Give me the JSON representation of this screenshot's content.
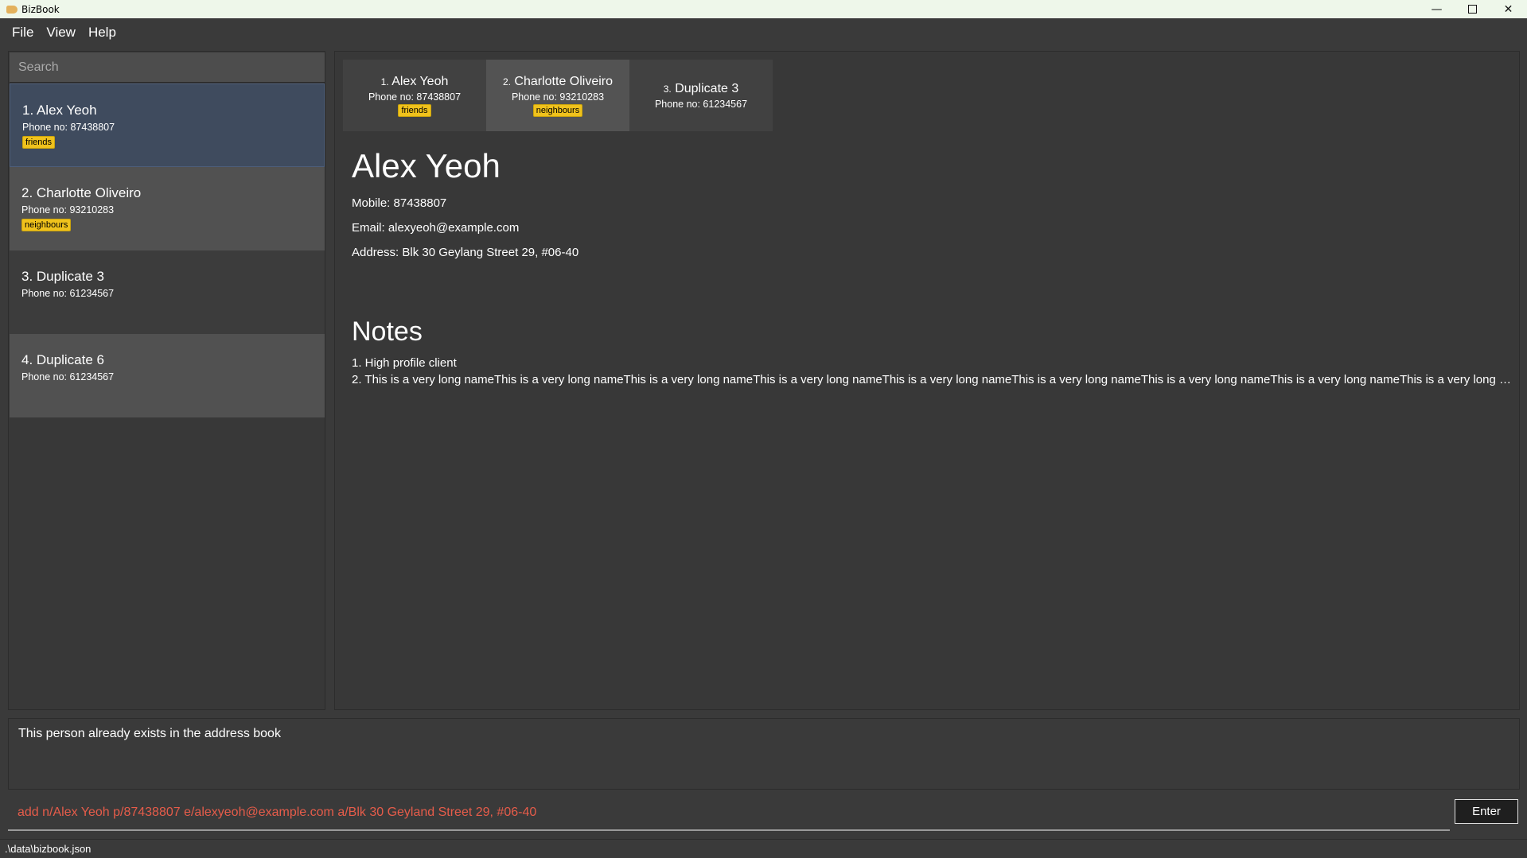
{
  "window": {
    "title": "BizBook",
    "minimize": "—",
    "close": "✕"
  },
  "menu": [
    "File",
    "View",
    "Help"
  ],
  "search": {
    "placeholder": "Search"
  },
  "persons": [
    {
      "index_name": "1. Alex Yeoh",
      "phone": "Phone no: 87438807",
      "tag": "friends"
    },
    {
      "index_name": "2. Charlotte Oliveiro",
      "phone": "Phone no: 93210283",
      "tag": "neighbours"
    },
    {
      "index_name": "3. Duplicate 3",
      "phone": "Phone no: 61234567",
      "tag": null
    },
    {
      "index_name": "4. Duplicate 6",
      "phone": "Phone no: 61234567",
      "tag": null
    }
  ],
  "tabs": [
    {
      "num": "1.",
      "name": "Alex Yeoh",
      "phone": "Phone no: 87438807",
      "tag": "friends"
    },
    {
      "num": "2.",
      "name": "Charlotte Oliveiro",
      "phone": "Phone no: 93210283",
      "tag": "neighbours"
    },
    {
      "num": "3.",
      "name": "Duplicate 3",
      "phone": "Phone no: 61234567",
      "tag": null
    }
  ],
  "detail": {
    "name": "Alex Yeoh",
    "mobile": "Mobile: 87438807",
    "email": "Email: alexyeoh@example.com",
    "address": "Address: Blk 30 Geylang Street 29, #06-40"
  },
  "notes": {
    "heading": "Notes",
    "items": [
      "1. High profile client",
      "2. This is a very long nameThis is a very long nameThis is a very long nameThis is a very long nameThis is a very long nameThis is a very long nameThis is a very long nameThis is a very long nameThis is a very long nameThis is a very long n..."
    ]
  },
  "result": "This person already exists in the address book",
  "command": {
    "value": "add n/Alex Yeoh p/87438807 e/alexyeoh@example.com a/Blk 30 Geyland Street 29, #06-40",
    "enter_label": "Enter"
  },
  "status": ".\\data\\bizbook.json",
  "colors": {
    "tag": "#f0c21c",
    "command_text": "#e65c4a",
    "selected_card": "#3f4b5e"
  }
}
